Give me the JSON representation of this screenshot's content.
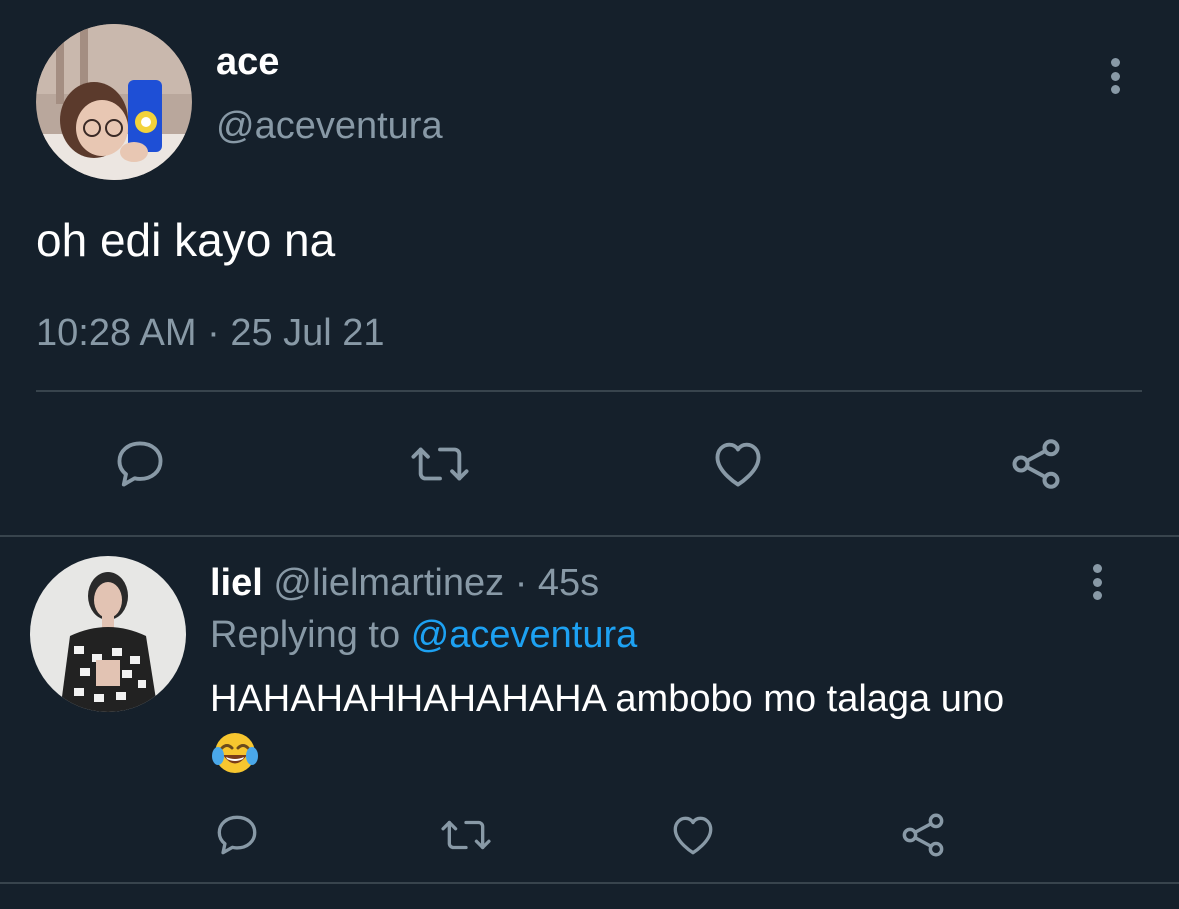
{
  "main_tweet": {
    "display_name": "ace",
    "handle": "@aceventura",
    "text": "oh edi kayo na",
    "timestamp": "10:28 AM · 25 Jul 21",
    "avatar_icon": "profile-photo-selfie",
    "actions": [
      "reply-icon",
      "retweet-icon",
      "like-icon",
      "share-icon"
    ]
  },
  "reply_tweet": {
    "display_name": "liel",
    "handle": "@lielmartinez",
    "separator": "·",
    "time_ago": "45s",
    "replying_prefix": "Replying to",
    "replying_to": "@aceventura",
    "text": "HAHAHAHHAHAHAHA ambobo mo talaga uno",
    "emoji": "face-with-tears-of-joy",
    "avatar_icon": "profile-photo-houndstooth",
    "actions": [
      "reply-icon",
      "retweet-icon",
      "like-icon",
      "share-icon"
    ]
  },
  "colors": {
    "background": "#15202b",
    "text_primary": "#ffffff",
    "text_secondary": "#8899a6",
    "divider": "#38444d",
    "link": "#1da1f2",
    "icon": "#8899a6"
  }
}
